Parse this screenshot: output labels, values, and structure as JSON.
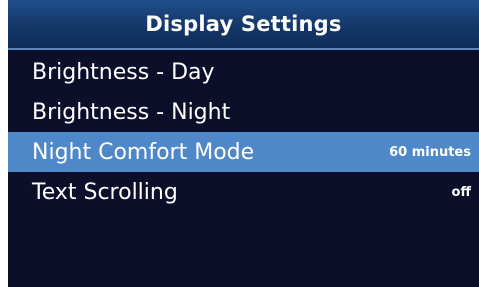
{
  "header": {
    "title": "Display Settings"
  },
  "menu": {
    "items": [
      {
        "label": "Brightness - Day",
        "value": ""
      },
      {
        "label": "Brightness - Night",
        "value": ""
      },
      {
        "label": "Night Comfort Mode",
        "value": "60 minutes",
        "selected": true
      },
      {
        "label": "Text Scrolling",
        "value": "off"
      }
    ]
  },
  "colors": {
    "screen_background": "#0b0f2a",
    "header_gradient_top": "#1f4f8c",
    "header_gradient_bottom": "#0f2c58",
    "header_border": "#5b86be",
    "selection_highlight": "#4f88c9",
    "text": "#ffffff"
  }
}
